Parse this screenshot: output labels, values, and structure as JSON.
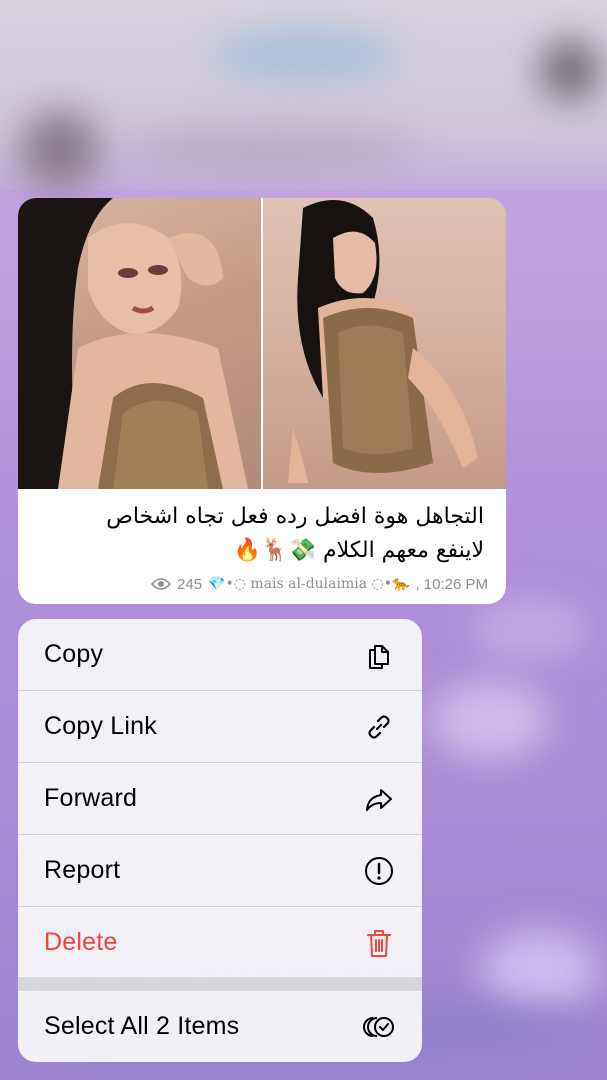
{
  "message": {
    "caption_line1": "التجاهل هوة افضل رده فعل تجاه اشخاص",
    "caption_line2": "لاينفع معهم الكلام 💸🦌🔥",
    "views": "245",
    "signature": "💎•◌ mais al-dulaimia ◌•🐆",
    "time": ", 10:26 PM",
    "photos": [
      {
        "name": "photo-left"
      },
      {
        "name": "photo-right"
      }
    ]
  },
  "menu": {
    "items": [
      {
        "label": "Copy",
        "icon": "copy-icon"
      },
      {
        "label": "Copy Link",
        "icon": "link-icon"
      },
      {
        "label": "Forward",
        "icon": "forward-icon"
      },
      {
        "label": "Report",
        "icon": "report-icon"
      },
      {
        "label": "Delete",
        "icon": "trash-icon",
        "destructive": true
      },
      {
        "label": "Select All 2 Items",
        "icon": "select-all-icon"
      }
    ],
    "destructive_color": "#f0443c"
  }
}
